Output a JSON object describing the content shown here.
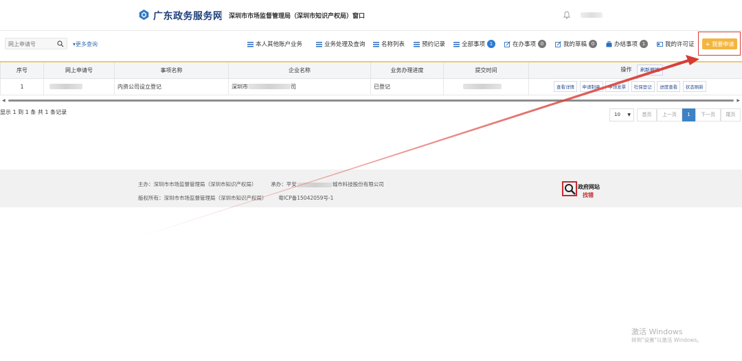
{
  "header": {
    "site_title": "广东政务服务网",
    "window_title": "深圳市市场监督管理局（深圳市知识产权局）窗口",
    "icons": [
      "logo-icon",
      "bell-icon"
    ]
  },
  "toolbar": {
    "search_placeholder": "网上申请号",
    "more_query": "更多查询",
    "nav": [
      {
        "label": "本人其他账户业务",
        "icon": "list-icon"
      },
      {
        "label": "业务处理及查询",
        "icon": "list-icon"
      },
      {
        "label": "名称列表",
        "icon": "list-icon"
      },
      {
        "label": "预约记录",
        "icon": "list-icon"
      },
      {
        "label": "全部事项",
        "icon": "list-icon",
        "badge": "1"
      },
      {
        "label": "在办事项",
        "icon": "edit-icon",
        "badge": "0"
      },
      {
        "label": "我的草稿",
        "icon": "edit-icon",
        "badge": "0"
      },
      {
        "label": "办结事项",
        "icon": "briefcase-icon",
        "badge": "1"
      },
      {
        "label": "我的许可证",
        "icon": "id-card-icon"
      }
    ],
    "apply_button": "我要申请"
  },
  "table": {
    "columns": [
      "序号",
      "网上申请号",
      "事项名称",
      "企业名称",
      "业务办理进度",
      "提交时间",
      "操作"
    ],
    "refresh_label": "刷新撤销",
    "rows": [
      {
        "index": "1",
        "item_name": "内资公司设立登记",
        "company_prefix": "深圳市",
        "company_suffix": "司",
        "progress": "已登记",
        "actions": [
          "查看详情",
          "申请制章",
          "申领发票",
          "社保登记",
          "进度查看",
          "状态刷新"
        ]
      }
    ]
  },
  "records_text": "显示 1 到 1 条 共 1 条记录",
  "pager": {
    "page_size": "10",
    "first": "首页",
    "prev": "上一页",
    "current": "1",
    "next": "下一页",
    "last": "尾页"
  },
  "footer": {
    "host_label": "主办：深圳市市场监督管理局（深圳市知识产权局）",
    "undertake_prefix": "承办：平安",
    "undertake_suffix": "城市科技股份有限公司",
    "copyright_label": "版权所有：深圳市市场监督管理局（深圳市知识产权局）",
    "icp": "粤ICP备15042059号-1",
    "gov_site": "政府网站",
    "find_error": "找错"
  },
  "watermark": {
    "line1": "激活 Windows",
    "line2": "转到\"设置\"以激活 Windows。"
  },
  "colors": {
    "brand_blue": "#1f3f7a",
    "apply_orange": "#f4b53f",
    "highlight_red": "#d73a33",
    "active_page": "#3c82c5"
  }
}
